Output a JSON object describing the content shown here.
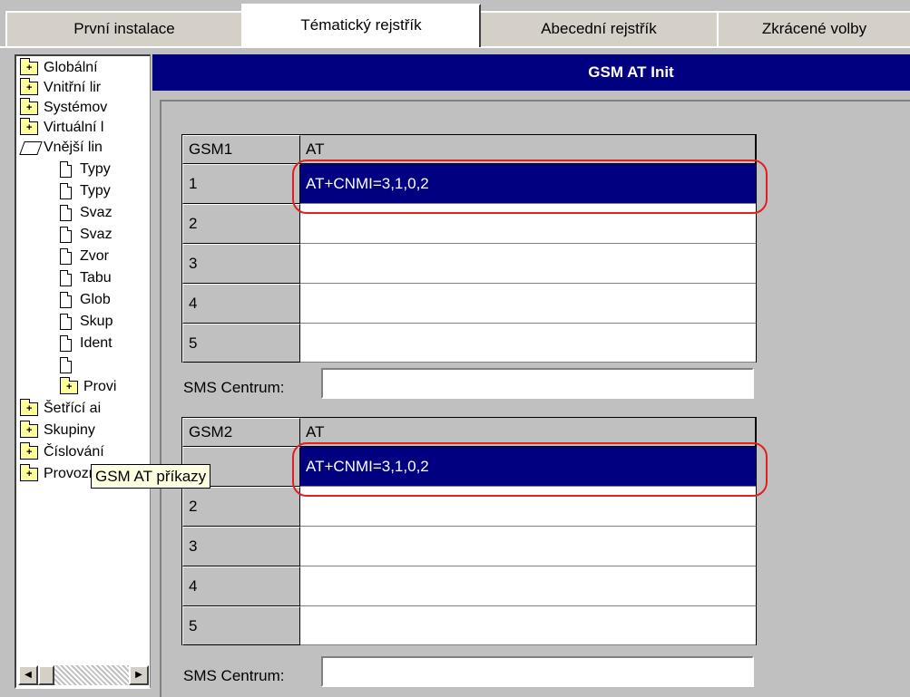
{
  "tabs": [
    "První instalace",
    "Tématický rejstřík",
    "Abecední rejstřík",
    "Zkrácené volby"
  ],
  "tree": {
    "items": [
      {
        "label": "Globální",
        "icon": "folder-icon"
      },
      {
        "label": "Vnitřní lir",
        "icon": "folder-icon"
      },
      {
        "label": "Systémov",
        "icon": "folder-icon"
      },
      {
        "label": "Virtuální l",
        "icon": "folder-icon"
      },
      {
        "label": "Vnější lin",
        "icon": "folder-open-icon"
      },
      {
        "label": "Typy",
        "icon": "document-icon"
      },
      {
        "label": "Typy",
        "icon": "document-icon"
      },
      {
        "label": "Svaz",
        "icon": "document-icon"
      },
      {
        "label": "Svaz",
        "icon": "document-icon"
      },
      {
        "label": "Zvor",
        "icon": "document-icon"
      },
      {
        "label": "Tabu",
        "icon": "document-icon"
      },
      {
        "label": "Glob",
        "icon": "document-icon"
      },
      {
        "label": "Skup",
        "icon": "document-icon"
      },
      {
        "label": "Ident",
        "icon": "document-icon"
      },
      {
        "label": "",
        "icon": "document-icon"
      },
      {
        "label": "Provi",
        "icon": "folder-icon"
      },
      {
        "label": "Šetřící ai",
        "icon": "folder-icon"
      },
      {
        "label": "Skupiny",
        "icon": "folder-icon"
      },
      {
        "label": "Číslování",
        "icon": "folder-icon"
      },
      {
        "label": "Provozní",
        "icon": "folder-icon"
      }
    ],
    "tooltip": "GSM AT příkazy"
  },
  "panel": {
    "title": "GSM AT Init",
    "gsm1": {
      "header_col1": "GSM1",
      "header_col2": "AT",
      "rows": [
        {
          "num": "1",
          "value": "AT+CNMI=3,1,0,2"
        },
        {
          "num": "2",
          "value": ""
        },
        {
          "num": "3",
          "value": ""
        },
        {
          "num": "4",
          "value": ""
        },
        {
          "num": "5",
          "value": ""
        }
      ],
      "sms_label": "SMS Centrum:",
      "sms_value": ""
    },
    "gsm2": {
      "header_col1": "GSM2",
      "header_col2": "AT",
      "rows": [
        {
          "num": "",
          "value": "AT+CNMI=3,1,0,2"
        },
        {
          "num": "2",
          "value": ""
        },
        {
          "num": "3",
          "value": ""
        },
        {
          "num": "4",
          "value": ""
        },
        {
          "num": "5",
          "value": ""
        }
      ],
      "sms_label": "SMS Centrum:",
      "sms_value": ""
    }
  },
  "colors": {
    "selection": "#000080",
    "highlight": "#e02020",
    "background": "#c0c0c0"
  }
}
